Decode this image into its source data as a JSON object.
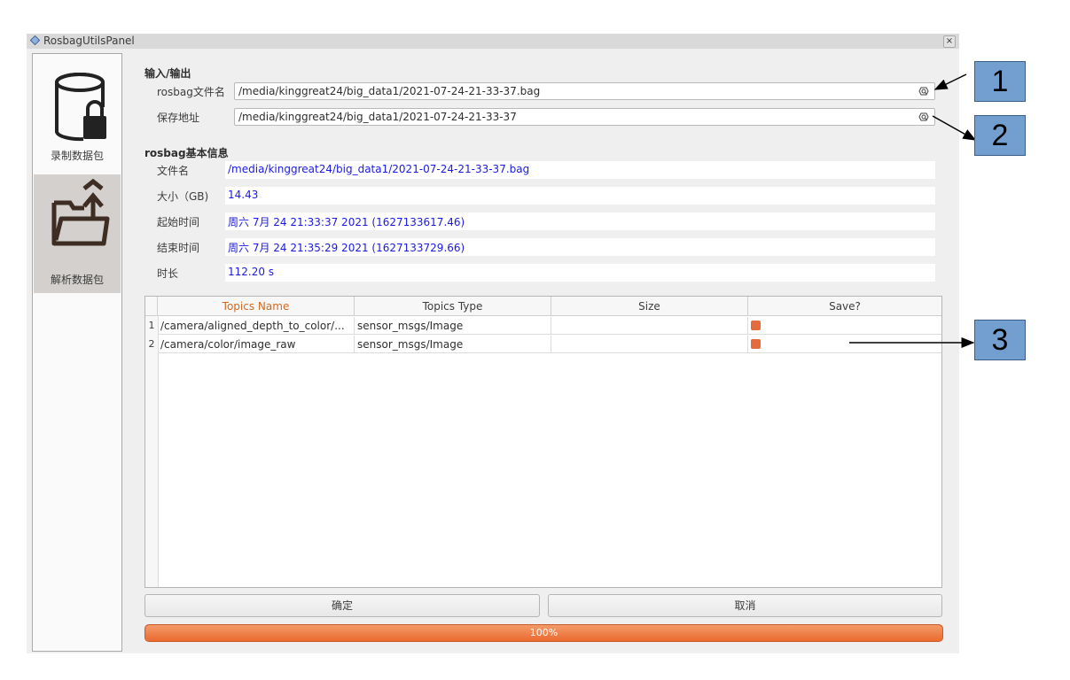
{
  "window": {
    "title": "RosbagUtilsPanel",
    "close_glyph": "×"
  },
  "sidebar": {
    "items": [
      {
        "label": "录制数据包",
        "icon": "database-lock-icon"
      },
      {
        "label": "解析数据包",
        "icon": "folder-upload-icon"
      }
    ]
  },
  "io": {
    "title": "输入/输出",
    "rosbag_label": "rosbag文件名",
    "rosbag_value": "/media/kinggreat24/big_data1/2021-07-24-21-33-37.bag",
    "save_label": "保存地址",
    "save_value": "/media/kinggreat24/big_data1/2021-07-24-21-33-37"
  },
  "info": {
    "title": "rosbag基本信息",
    "rows": [
      {
        "label": "文件名",
        "value": "/media/kinggreat24/big_data1/2021-07-24-21-33-37.bag"
      },
      {
        "label": "大小（GB)",
        "value": "14.43"
      },
      {
        "label": "起始时间",
        "value": "周六 7月 24 21:33:37 2021 (1627133617.46)"
      },
      {
        "label": "结束时间",
        "value": "周六 7月 24 21:35:29 2021 (1627133729.66)"
      },
      {
        "label": "时长",
        "value": "112.20 s"
      }
    ]
  },
  "table": {
    "columns": [
      "Topics Name",
      "Topics Type",
      "Size",
      "Save?"
    ],
    "rows": [
      {
        "num": "1",
        "name": "/camera/aligned_depth_to_color/...",
        "type": "sensor_msgs/Image",
        "size": "",
        "save": true
      },
      {
        "num": "2",
        "name": "/camera/color/image_raw",
        "type": "sensor_msgs/Image",
        "size": "",
        "save": true
      }
    ]
  },
  "buttons": {
    "ok": "确定",
    "cancel": "取消"
  },
  "progress": {
    "value": 1.0,
    "text": "100%"
  },
  "callouts": [
    "1",
    "2",
    "3"
  ],
  "colors": {
    "accent": "#f07a43",
    "link": "#1a1ae6",
    "callout": "#729fcf",
    "header_active": "#d2691e"
  }
}
